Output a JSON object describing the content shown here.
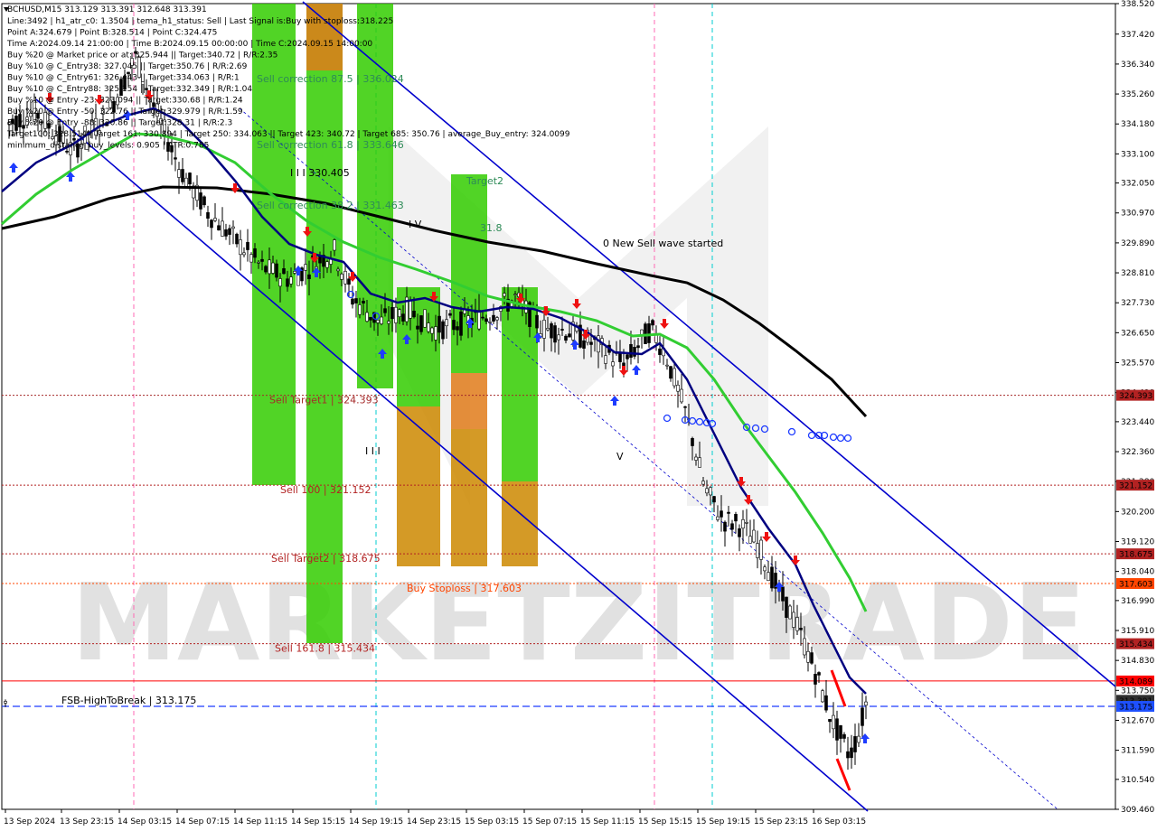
{
  "chart_data": {
    "type": "candlestick",
    "symbol": "BCHUSD,M15",
    "ohlc_header": "BCHUSD,M15  313.129 313.391 312.648 313.391",
    "info_lines": [
      "Line:3492 | h1_atr_c0: 1.3504 | tema_h1_status: Sell | Last Signal is:Buy with stoploss:318.225",
      "Point A:324.679 | Point B:328.514 | Point C:324.475",
      "Time A:2024.09.14 21:00:00 | Time B:2024.09.15 00:00:00 | Time C:2024.09.15 14:00:00",
      "Buy %20 @ Market price or at: 325.944 || Target:340.72 | R/R:2.35",
      "Buy %10 @ C_Entry38: 327.045 || Target:350.76 | R/R:2.69",
      "Buy %10 @ C_Entry61: 326.443 || Target:334.063 | R/R:1",
      "Buy %10 @ C_Entry88: 325.154 || Target:332.349 | R/R:1.04",
      "Buy %10 @ Entry -23: 323.094 || Target:330.68 | R/R:1.24",
      "Buy %20 @ Entry -50: 322.76 || Target:329.979 | R/R:1.59",
      "Buy %20 @ Entry -88: 320.86 || Target:328.31 | R/R:2.3",
      "Target100: 328.514 | Target 161: 330.894 | Target 250: 334.063 || Target 423: 340.72 | Target 685: 350.76 | average_Buy_entry: 324.0099",
      "minimum_distance_buy_levels: 0.905 | ATR:0.785"
    ],
    "y_axis": {
      "min": 309.46,
      "max": 338.52,
      "ticks": [
        "338.520",
        "337.420",
        "336.340",
        "335.260",
        "334.180",
        "333.100",
        "332.050",
        "330.970",
        "329.890",
        "328.810",
        "327.730",
        "326.650",
        "325.570",
        "324.490",
        "323.440",
        "322.360",
        "321.280",
        "320.200",
        "319.120",
        "318.040",
        "316.990",
        "315.910",
        "314.830",
        "313.750",
        "312.670",
        "311.590",
        "310.540",
        "309.460"
      ]
    },
    "x_axis": {
      "ticks": [
        "13 Sep 2024",
        "13 Sep 23:15",
        "14 Sep 03:15",
        "14 Sep 07:15",
        "14 Sep 11:15",
        "14 Sep 15:15",
        "14 Sep 19:15",
        "14 Sep 23:15",
        "15 Sep 03:15",
        "15 Sep 07:15",
        "15 Sep 11:15",
        "15 Sep 15:15",
        "15 Sep 19:15",
        "15 Sep 23:15",
        "16 Sep 03:15"
      ]
    },
    "price_tags": [
      {
        "value": "324.393",
        "price": 324.393,
        "color": "#b22222"
      },
      {
        "value": "321.152",
        "price": 321.152,
        "color": "#b22222"
      },
      {
        "value": "318.675",
        "price": 318.675,
        "color": "#b22222"
      },
      {
        "value": "317.603",
        "price": 317.603,
        "color": "#ff4500"
      },
      {
        "value": "315.434",
        "price": 315.434,
        "color": "#b22222"
      },
      {
        "value": "314.089",
        "price": 314.089,
        "color": "#ff0000"
      },
      {
        "value": "313.391",
        "price": 313.391,
        "color": "#2f2f2f"
      },
      {
        "value": "313.175",
        "price": 313.175,
        "color": "#1e50ff"
      }
    ],
    "levels": [
      {
        "label": "Sell Target1 | 324.393",
        "price": 324.393,
        "color": "#a52a2a",
        "style": "dotted"
      },
      {
        "label": "Sell 100 | 321.152",
        "price": 321.152,
        "color": "#b22222",
        "style": "dotted"
      },
      {
        "label": "Sell Target2 | 318.675",
        "price": 318.675,
        "color": "#b22222",
        "style": "dotted"
      },
      {
        "label": "Buy Stoploss | 317.603",
        "price": 317.603,
        "color": "#ff4500",
        "style": "dotted"
      },
      {
        "label": "Sell 161.8 | 315.434",
        "price": 315.434,
        "color": "#b22222",
        "style": "dotted"
      },
      {
        "label": "",
        "price": 314.089,
        "color": "#ff0000",
        "style": "solid"
      },
      {
        "label": "FSB-HighToBreak | 313.175",
        "price": 313.175,
        "color": "#1e3cff",
        "style": "dashed"
      }
    ],
    "annotations": [
      {
        "text": "Sell correction 87.5 | 336.024",
        "price": 336.024,
        "color": "#2e8b57"
      },
      {
        "text": "Sell correction 61.8 | 333.646",
        "price": 333.646,
        "color": "#2e8b57"
      },
      {
        "text": "Sell correction 38.2 | 331.463",
        "price": 331.463,
        "color": "#2e8b57"
      },
      {
        "text": "Target2",
        "color": "#2e8b57"
      },
      {
        "text": "31.8",
        "color": "#2e8b57"
      },
      {
        "text": "0 New Sell wave started",
        "color": "#000000"
      },
      {
        "text": "I I I 330.405",
        "color": "#000000"
      },
      {
        "text": "I V",
        "color": "#000000"
      },
      {
        "text": "I I I",
        "color": "#000000"
      },
      {
        "text": "V",
        "color": "#000000"
      }
    ],
    "watermark": "MARKETZITRADE",
    "colors": {
      "candle": "#000000",
      "ema_fast": "#000080",
      "ema_mid": "#32cd32",
      "ema_slow": "#000000",
      "channel": "#0000cd",
      "green_zone": "#33cc00",
      "orange_zone": "#cc8800",
      "buy_arrow": "#1e3cff",
      "sell_arrow": "#ee1111"
    },
    "grid": false
  }
}
